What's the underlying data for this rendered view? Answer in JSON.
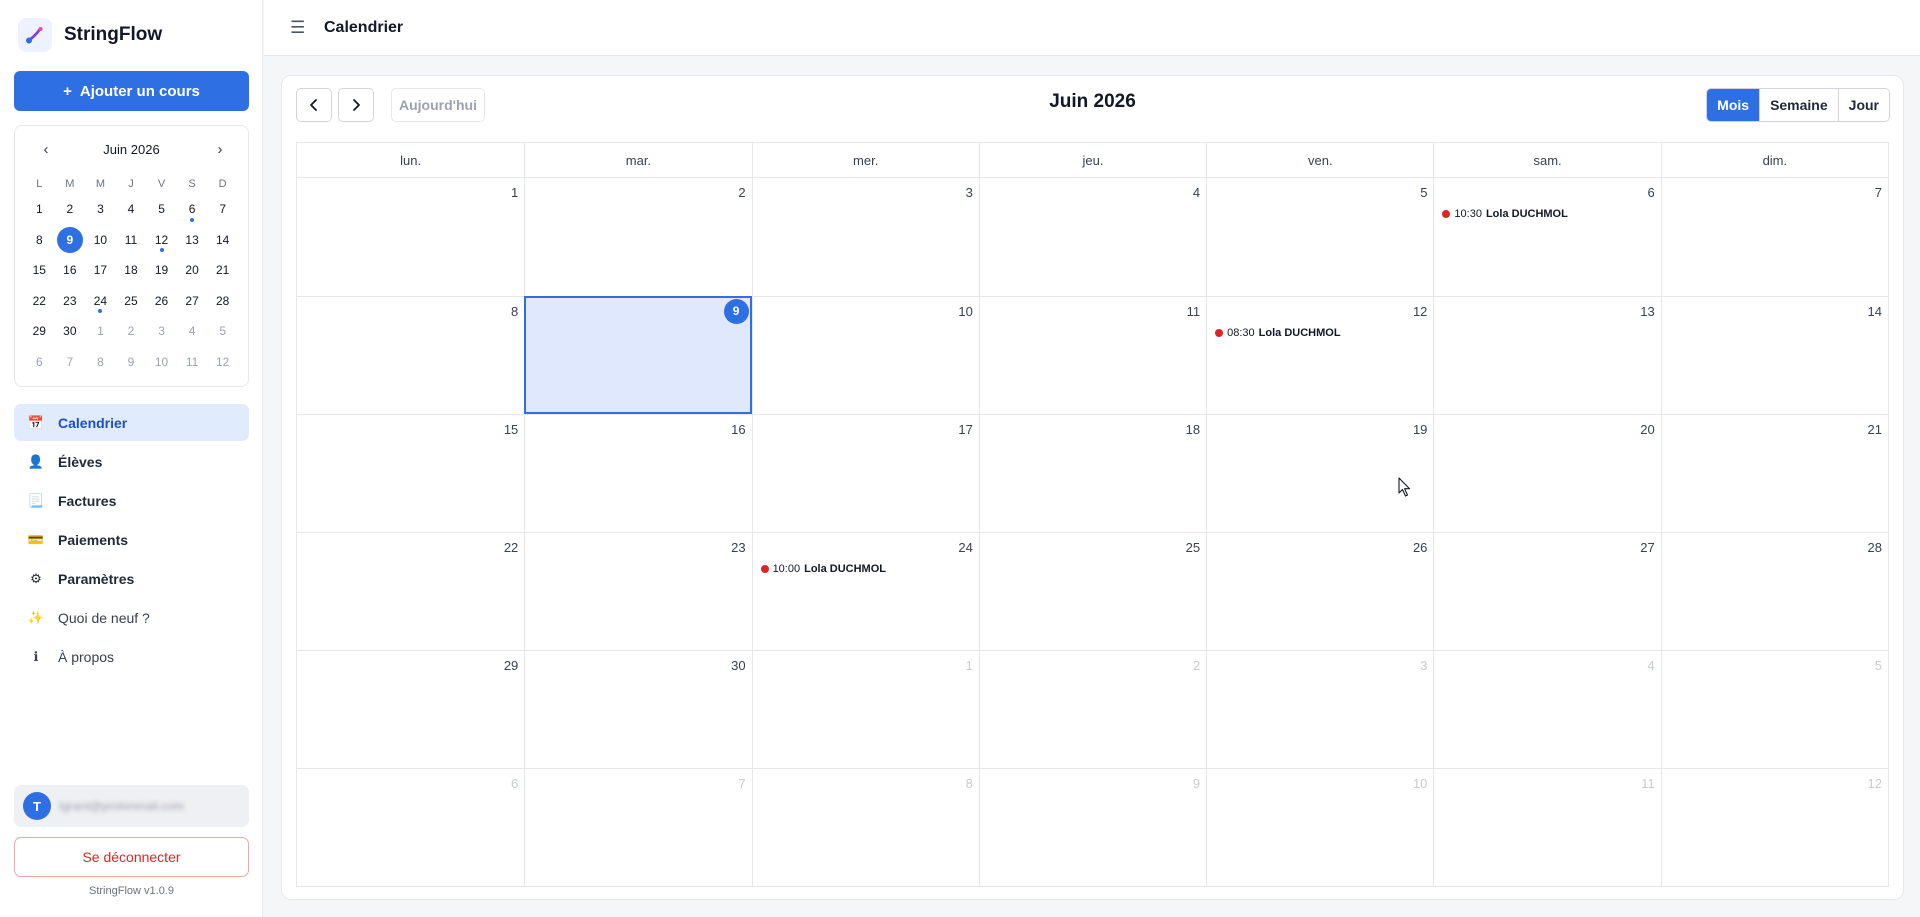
{
  "app": {
    "name": "StringFlow",
    "version": "StringFlow v1.0.9"
  },
  "sidebar": {
    "add_button": {
      "icon": "+",
      "label": "Ajouter un cours"
    },
    "mini_calendar": {
      "title": "Juin 2026",
      "prev": "‹",
      "next": "›",
      "weekdays": [
        "L",
        "M",
        "M",
        "J",
        "V",
        "S",
        "D"
      ],
      "weeks": [
        [
          {
            "d": "1"
          },
          {
            "d": "2"
          },
          {
            "d": "3"
          },
          {
            "d": "4"
          },
          {
            "d": "5"
          },
          {
            "d": "6",
            "dot": true
          },
          {
            "d": "7"
          }
        ],
        [
          {
            "d": "8"
          },
          {
            "d": "9",
            "today": true
          },
          {
            "d": "10"
          },
          {
            "d": "11"
          },
          {
            "d": "12",
            "dot": true
          },
          {
            "d": "13"
          },
          {
            "d": "14"
          }
        ],
        [
          {
            "d": "15"
          },
          {
            "d": "16"
          },
          {
            "d": "17"
          },
          {
            "d": "18"
          },
          {
            "d": "19"
          },
          {
            "d": "20"
          },
          {
            "d": "21"
          }
        ],
        [
          {
            "d": "22"
          },
          {
            "d": "23"
          },
          {
            "d": "24",
            "dot": true
          },
          {
            "d": "25"
          },
          {
            "d": "26"
          },
          {
            "d": "27"
          },
          {
            "d": "28"
          }
        ],
        [
          {
            "d": "29"
          },
          {
            "d": "30"
          },
          {
            "d": "1",
            "other": true
          },
          {
            "d": "2",
            "other": true
          },
          {
            "d": "3",
            "other": true
          },
          {
            "d": "4",
            "other": true
          },
          {
            "d": "5",
            "other": true
          }
        ],
        [
          {
            "d": "6",
            "other": true
          },
          {
            "d": "7",
            "other": true
          },
          {
            "d": "8",
            "other": true
          },
          {
            "d": "9",
            "other": true
          },
          {
            "d": "10",
            "other": true
          },
          {
            "d": "11",
            "other": true
          },
          {
            "d": "12",
            "other": true
          }
        ]
      ]
    },
    "nav": [
      {
        "key": "calendrier",
        "label": "Calendrier",
        "icon": "calendar-icon",
        "glyph": "📅",
        "active": true
      },
      {
        "key": "eleves",
        "label": "Élèves",
        "icon": "student-icon",
        "glyph": "👤"
      },
      {
        "key": "factures",
        "label": "Factures",
        "icon": "invoice-icon",
        "glyph": "📃"
      },
      {
        "key": "paiements",
        "label": "Paiements",
        "icon": "payment-icon",
        "glyph": "💳"
      },
      {
        "key": "parametres",
        "label": "Paramètres",
        "icon": "gear-icon",
        "glyph": "⚙"
      },
      {
        "key": "quoi-de-neuf",
        "label": "Quoi de neuf ?",
        "icon": "sparkles-icon",
        "glyph": "✨",
        "muted": true
      },
      {
        "key": "a-propos",
        "label": "À propos",
        "icon": "info-icon",
        "glyph": "ℹ",
        "muted": true
      }
    ],
    "user": {
      "initial": "T",
      "email": "tgrant@protonmail.com"
    },
    "logout_label": "Se déconnecter"
  },
  "topbar": {
    "menu_icon": "☰",
    "title": "Calendrier"
  },
  "calendar": {
    "title": "Juin 2026",
    "prev_icon": "chevron-left-icon",
    "next_icon": "chevron-right-icon",
    "today_label": "Aujourd'hui",
    "views": [
      {
        "label": "Mois",
        "active": true
      },
      {
        "label": "Semaine"
      },
      {
        "label": "Jour"
      }
    ],
    "weekdays": [
      "lun.",
      "mar.",
      "mer.",
      "jeu.",
      "ven.",
      "sam.",
      "dim."
    ],
    "weeks": [
      [
        {
          "d": "1"
        },
        {
          "d": "2"
        },
        {
          "d": "3"
        },
        {
          "d": "4"
        },
        {
          "d": "5"
        },
        {
          "d": "6",
          "events": [
            {
              "time": "10:30",
              "name": "Lola DUCHMOL"
            }
          ]
        },
        {
          "d": "7"
        }
      ],
      [
        {
          "d": "8"
        },
        {
          "d": "9",
          "today": true
        },
        {
          "d": "10"
        },
        {
          "d": "11"
        },
        {
          "d": "12",
          "events": [
            {
              "time": "08:30",
              "name": "Lola DUCHMOL"
            }
          ]
        },
        {
          "d": "13"
        },
        {
          "d": "14"
        }
      ],
      [
        {
          "d": "15"
        },
        {
          "d": "16"
        },
        {
          "d": "17"
        },
        {
          "d": "18"
        },
        {
          "d": "19"
        },
        {
          "d": "20"
        },
        {
          "d": "21"
        }
      ],
      [
        {
          "d": "22"
        },
        {
          "d": "23"
        },
        {
          "d": "24",
          "events": [
            {
              "time": "10:00",
              "name": "Lola DUCHMOL"
            }
          ]
        },
        {
          "d": "25"
        },
        {
          "d": "26"
        },
        {
          "d": "27"
        },
        {
          "d": "28"
        }
      ],
      [
        {
          "d": "29"
        },
        {
          "d": "30"
        },
        {
          "d": "1",
          "other": true
        },
        {
          "d": "2",
          "other": true
        },
        {
          "d": "3",
          "other": true
        },
        {
          "d": "4",
          "other": true
        },
        {
          "d": "5",
          "other": true
        }
      ],
      [
        {
          "d": "6",
          "other": true
        },
        {
          "d": "7",
          "other": true
        },
        {
          "d": "8",
          "other": true
        },
        {
          "d": "9",
          "other": true
        },
        {
          "d": "10",
          "other": true
        },
        {
          "d": "11",
          "other": true
        },
        {
          "d": "12",
          "other": true
        }
      ]
    ]
  },
  "colors": {
    "accent": "#2f6fe4",
    "event_dot": "#dc2626",
    "today_bg": "#dfe8fc",
    "danger": "#dc2626"
  }
}
